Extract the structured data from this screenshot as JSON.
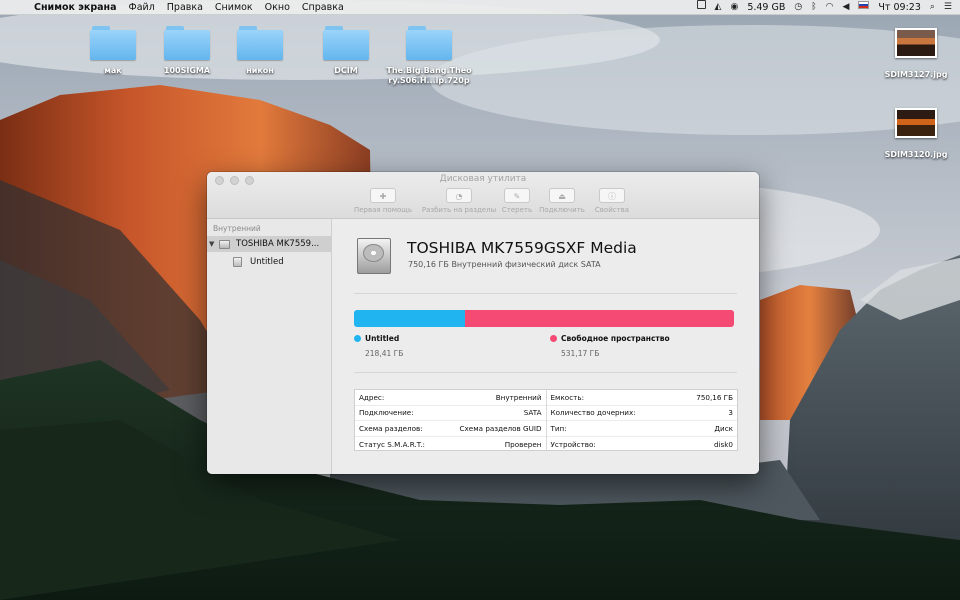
{
  "menubar": {
    "apple_glyph": "",
    "app_name": "Снимок экрана",
    "items": [
      "Файл",
      "Правка",
      "Снимок",
      "Окно",
      "Справка"
    ],
    "memory": "5.49 GB",
    "clock": "Чт 09:23"
  },
  "desktop": {
    "folders": [
      "мак",
      "100SIGMA",
      "никон",
      "DCIM",
      "The.Big.Bang.Theo ry.S06.H...ip.720p"
    ],
    "files": [
      "SDIM3127.jpg",
      "SDIM3120.jpg"
    ]
  },
  "window": {
    "title": "Дисковая утилита",
    "toolbar": [
      {
        "label": "Первая помощь",
        "glyph": "✚"
      },
      {
        "label": "Разбить на разделы",
        "glyph": "◔"
      },
      {
        "label": "Стереть",
        "glyph": "✎"
      },
      {
        "label": "Подключить",
        "glyph": "⏏"
      },
      {
        "label": "Свойства",
        "glyph": "ⓘ"
      }
    ],
    "sidebar": {
      "section": "Внутренний",
      "disk": "TOSHIBA MK7559...",
      "volume": "Untitled"
    },
    "disk": {
      "name": "TOSHIBA MK7559GSXF Media",
      "subtitle": "750,16 ГБ Внутренний физический диск SATA"
    },
    "usage": {
      "used_fraction": 0.291,
      "used_color": "#20b4f0",
      "free_color": "#f44a74",
      "used_name": "Untitled",
      "used_size": "218,41 ГБ",
      "free_name": "Свободное пространство",
      "free_size": "531,17 ГБ"
    },
    "info": {
      "left": [
        {
          "label": "Адрес:",
          "value": "Внутренний"
        },
        {
          "label": "Подключение:",
          "value": "SATA"
        },
        {
          "label": "Схема разделов:",
          "value": "Схема разделов GUID"
        },
        {
          "label": "Статус S.M.A.R.T.:",
          "value": "Проверен"
        }
      ],
      "right": [
        {
          "label": "Емкость:",
          "value": "750,16 ГБ"
        },
        {
          "label": "Количество дочерних:",
          "value": "3"
        },
        {
          "label": "Тип:",
          "value": "Диск"
        },
        {
          "label": "Устройство:",
          "value": "disk0"
        }
      ]
    }
  }
}
